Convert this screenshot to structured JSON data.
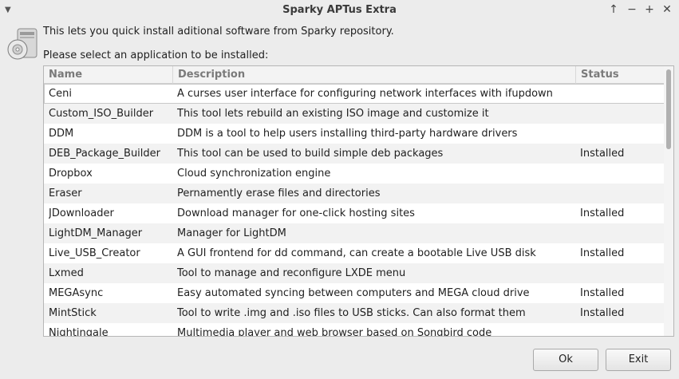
{
  "window": {
    "title": "Sparky APTus Extra",
    "controls": [
      "↑",
      "−",
      "+",
      "✕"
    ]
  },
  "intro_text": "This lets you quick install aditional software from Sparky repository.",
  "prompt_text": "Please select an application to be installed:",
  "table": {
    "columns": [
      "Name",
      "Description",
      "Status"
    ],
    "rows": [
      {
        "name": "Ceni",
        "description": "A curses user interface for configuring network interfaces with ifupdown",
        "status": ""
      },
      {
        "name": "Custom_ISO_Builder",
        "description": "This tool lets rebuild an existing ISO image and customize it",
        "status": ""
      },
      {
        "name": "DDM",
        "description": "DDM is a tool to help users installing third-party hardware drivers",
        "status": ""
      },
      {
        "name": "DEB_Package_Builder",
        "description": "This tool can be used to build simple deb packages",
        "status": "Installed"
      },
      {
        "name": "Dropbox",
        "description": "Cloud synchronization engine",
        "status": ""
      },
      {
        "name": "Eraser",
        "description": "Pernamently erase files and directories",
        "status": ""
      },
      {
        "name": "JDownloader",
        "description": "Download manager for one-click hosting sites",
        "status": "Installed"
      },
      {
        "name": "LightDM_Manager",
        "description": "Manager for LightDM",
        "status": ""
      },
      {
        "name": "Live_USB_Creator",
        "description": "A GUI frontend for dd command, can create a bootable Live USB disk",
        "status": "Installed"
      },
      {
        "name": "Lxmed",
        "description": "Tool to manage and reconfigure LXDE menu",
        "status": ""
      },
      {
        "name": "MEGAsync",
        "description": "Easy automated syncing between computers and MEGA cloud drive",
        "status": "Installed"
      },
      {
        "name": "MintStick",
        "description": "Tool to write .img and .iso files to USB sticks. Can also format them",
        "status": "Installed"
      },
      {
        "name": "Nightingale",
        "description": "Multimedia player and web browser based on Songbird code",
        "status": ""
      }
    ]
  },
  "buttons": {
    "ok": "Ok",
    "exit": "Exit"
  }
}
